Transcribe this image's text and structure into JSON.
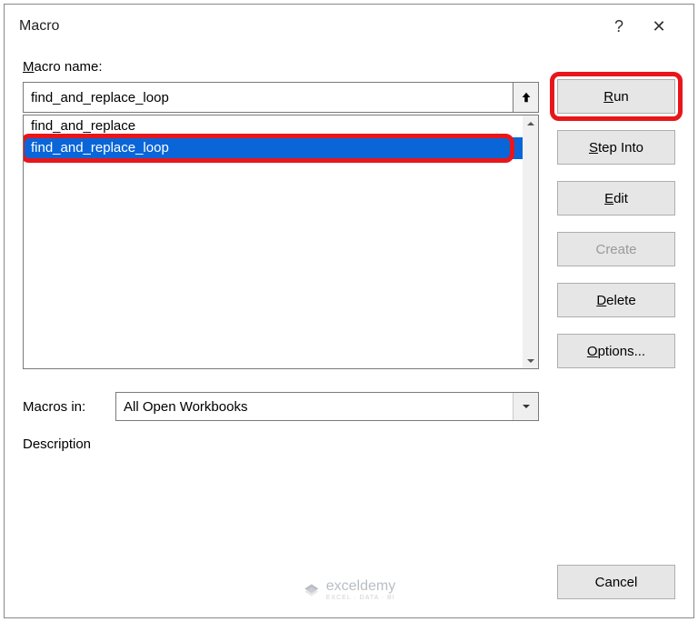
{
  "title": "Macro",
  "help": "?",
  "close": "✕",
  "labels": {
    "macro_name_pre": "M",
    "macro_name_post": "acro name:",
    "macros_in_pre": "Macros in",
    "macros_in_post": ":",
    "description": "Description"
  },
  "macro_name_value": "find_and_replace_loop",
  "list": [
    {
      "text": "find_and_replace",
      "selected": false
    },
    {
      "text": "find_and_replace_loop",
      "selected": true
    }
  ],
  "macros_in": "All Open Workbooks",
  "buttons": {
    "run_u": "R",
    "run_rest": "un",
    "step_u": "S",
    "step_rest": "tep Into",
    "edit_u": "E",
    "edit_rest": "dit",
    "create": "Create",
    "delete_u": "D",
    "delete_rest": "elete",
    "options_u": "O",
    "options_rest": "ptions...",
    "cancel": "Cancel"
  },
  "watermark": {
    "brand": "exceldemy",
    "tag": "EXCEL · DATA · BI"
  }
}
